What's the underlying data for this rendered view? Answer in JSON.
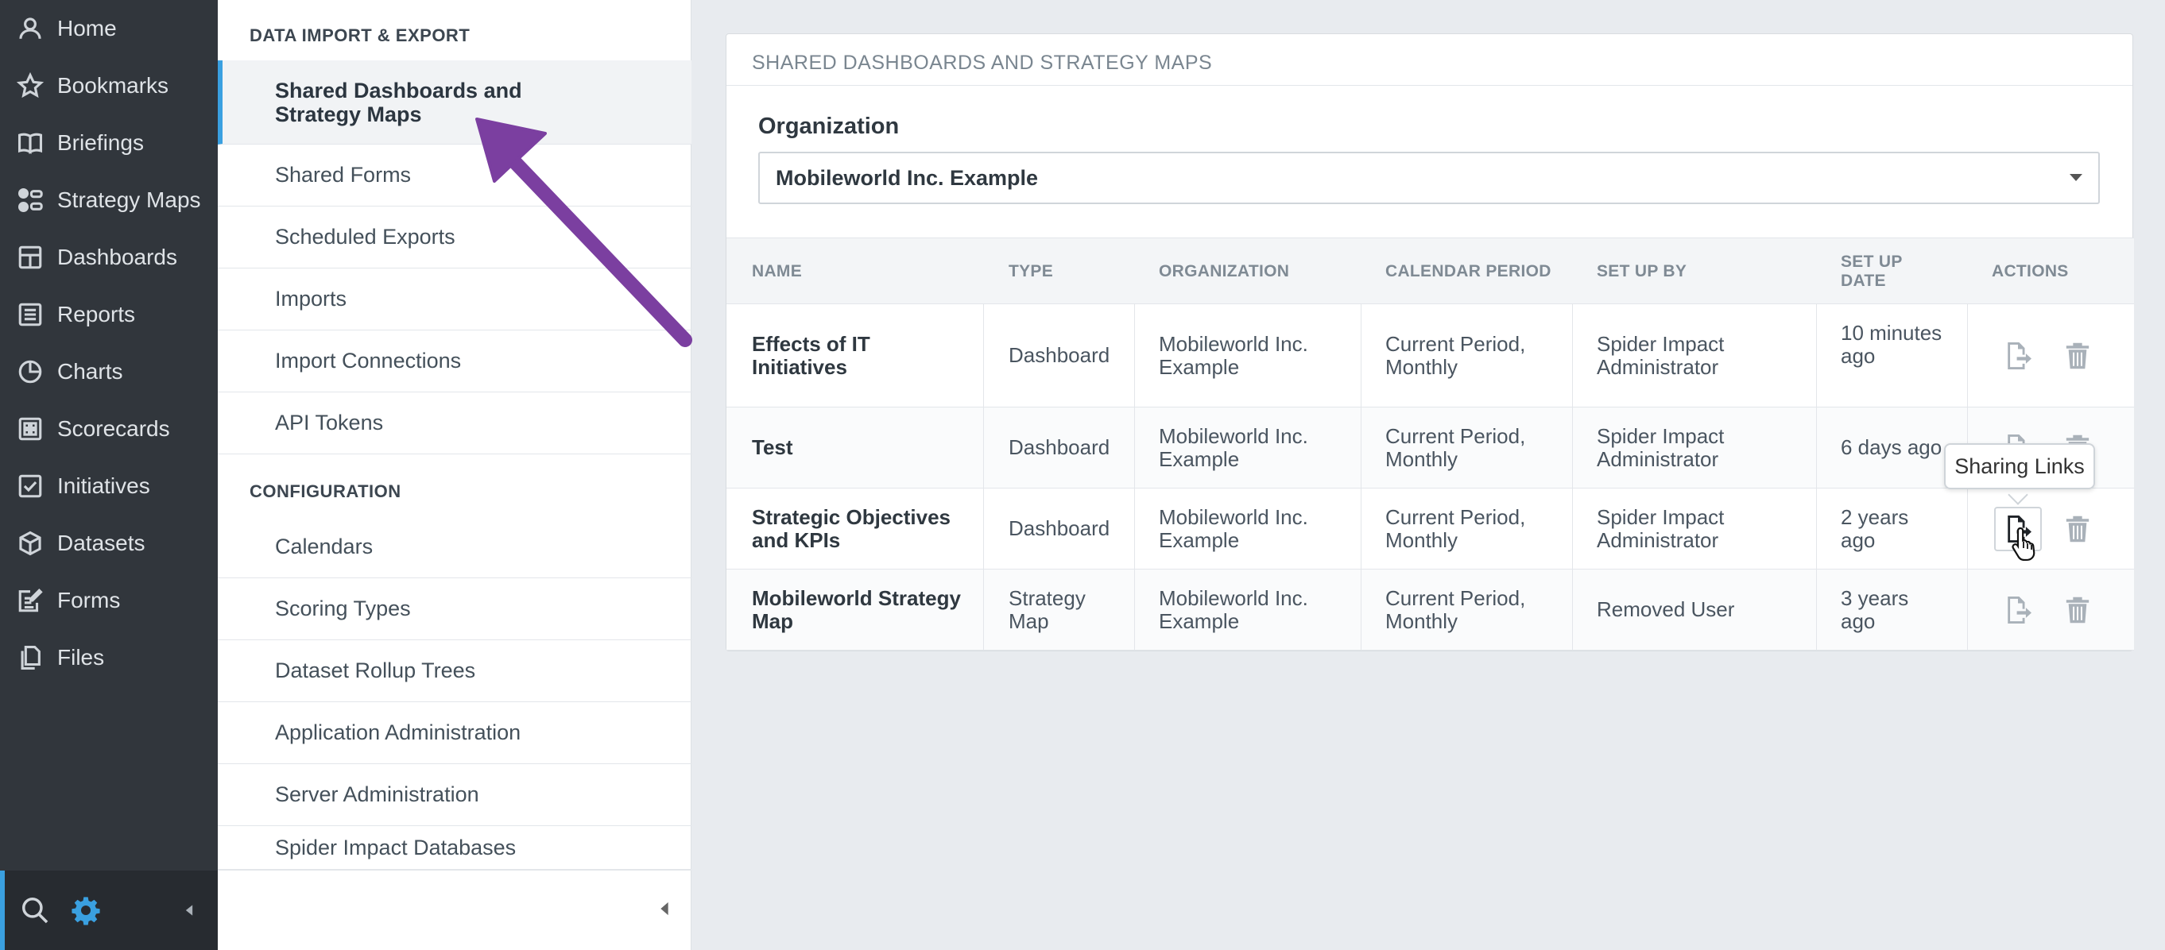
{
  "nav": {
    "items": [
      {
        "label": "Home",
        "icon": "user-icon"
      },
      {
        "label": "Bookmarks",
        "icon": "star-icon"
      },
      {
        "label": "Briefings",
        "icon": "book-icon"
      },
      {
        "label": "Strategy Maps",
        "icon": "strategy-map-icon"
      },
      {
        "label": "Dashboards",
        "icon": "dashboard-icon"
      },
      {
        "label": "Reports",
        "icon": "report-icon"
      },
      {
        "label": "Charts",
        "icon": "pie-chart-icon"
      },
      {
        "label": "Scorecards",
        "icon": "scorecard-icon"
      },
      {
        "label": "Initiatives",
        "icon": "checkbox-icon"
      },
      {
        "label": "Datasets",
        "icon": "cube-icon"
      },
      {
        "label": "Forms",
        "icon": "form-icon"
      },
      {
        "label": "Files",
        "icon": "files-icon"
      }
    ],
    "accent_color": "#3aa0e0"
  },
  "menu": {
    "section1": "DATA IMPORT & EXPORT",
    "section1_items": [
      "Shared Dashboards and Strategy Maps",
      "Shared Forms",
      "Scheduled Exports",
      "Imports",
      "Import Connections",
      "API Tokens"
    ],
    "section2": "CONFIGURATION",
    "section2_items": [
      "Calendars",
      "Scoring Types",
      "Dataset Rollup Trees",
      "Application Administration",
      "Server Administration",
      "Spider Impact Databases"
    ]
  },
  "main": {
    "title": "SHARED DASHBOARDS AND STRATEGY MAPS",
    "org_label": "Organization",
    "org_value": "Mobileworld Inc. Example",
    "columns": [
      "NAME",
      "TYPE",
      "ORGANIZATION",
      "CALENDAR PERIOD",
      "SET UP BY",
      "SET UP DATE",
      "ACTIONS"
    ],
    "rows": [
      {
        "name": "Effects of IT Initiatives",
        "type": "Dashboard",
        "org": "Mobileworld Inc. Example",
        "period": "Current Period, Monthly",
        "setup_by": "Spider Impact Administrator",
        "date": "10 minutes ago"
      },
      {
        "name": "Test",
        "type": "Dashboard",
        "org": "Mobileworld Inc. Example",
        "period": "Current Period, Monthly",
        "setup_by": "Spider Impact Administrator",
        "date": "6 days ago"
      },
      {
        "name": "Strategic Objectives and KPIs",
        "type": "Dashboard",
        "org": "Mobileworld Inc. Example",
        "period": "Current Period, Monthly",
        "setup_by": "Spider Impact Administrator",
        "date": "2 years ago"
      },
      {
        "name": "Mobileworld Strategy Map",
        "type": "Strategy Map",
        "org": "Mobileworld Inc. Example",
        "period": "Current Period, Monthly",
        "setup_by": "Removed User",
        "date": "3 years ago"
      }
    ],
    "tooltip": "Sharing Links",
    "annotation_color": "#7b3fa0"
  }
}
